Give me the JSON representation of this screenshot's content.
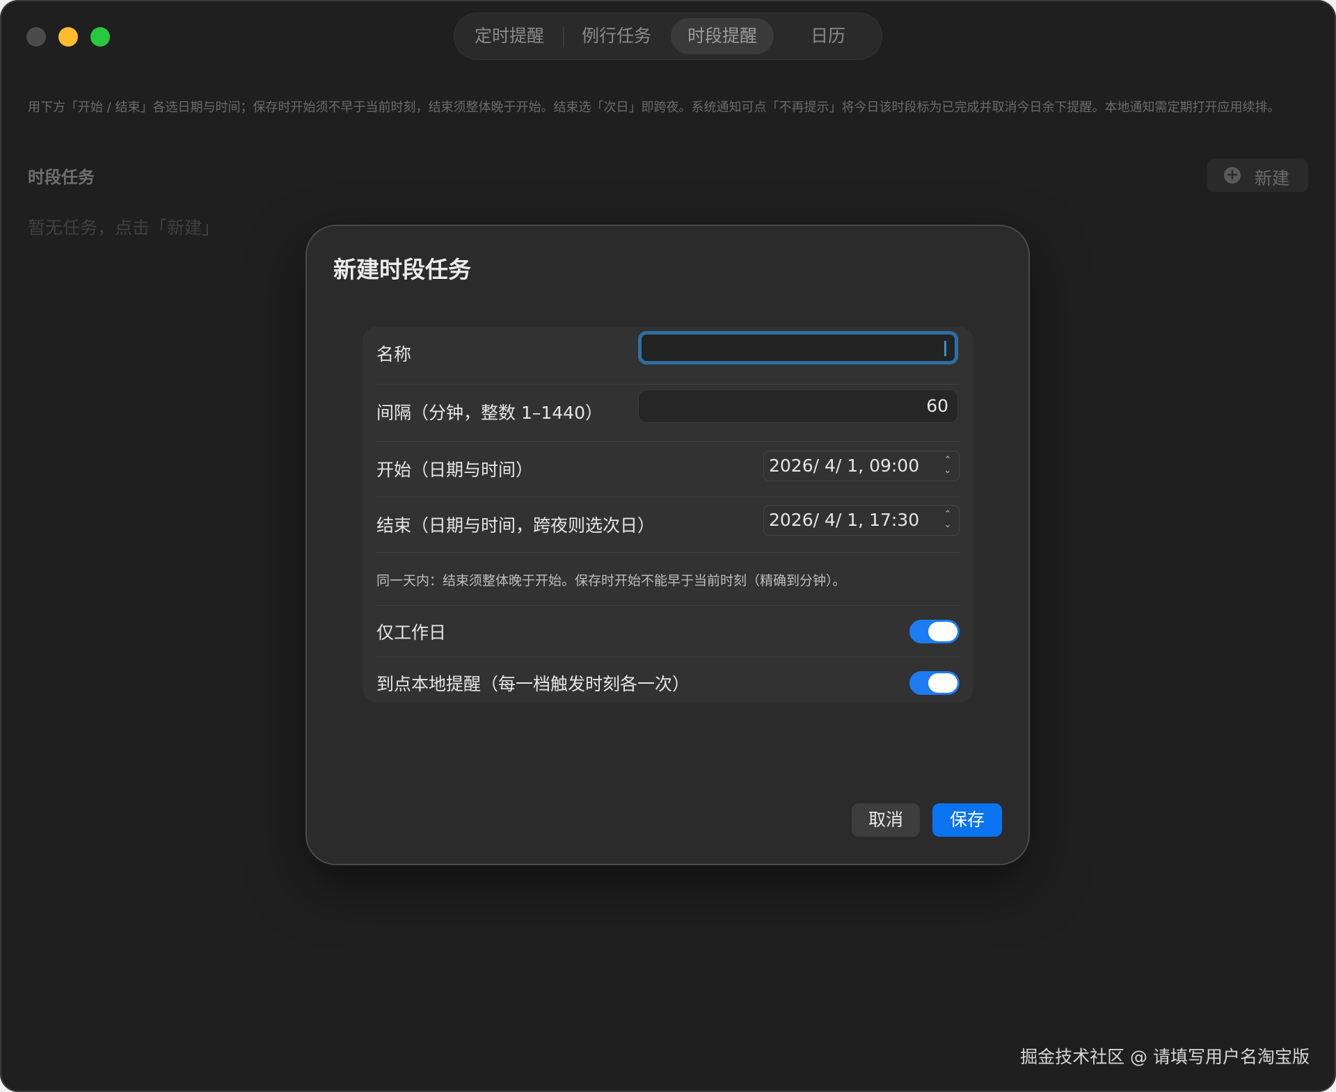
{
  "window": {
    "traffic_lights": [
      "close",
      "minimize",
      "zoom"
    ]
  },
  "tabs": [
    {
      "label": "定时提醒",
      "active": false
    },
    {
      "label": "例行任务",
      "active": false
    },
    {
      "label": "时段提醒",
      "active": true
    },
    {
      "label": "日历",
      "active": false
    }
  ],
  "page": {
    "description": "用下方「开始 / 结束」各选日期与时间；保存时开始须不早于当前时刻，结束须整体晚于开始。结束选「次日」即跨夜。系统通知可点「不再提示」将今日该时段标为已完成并取消今日余下提醒。本地通知需定期打开应用续排。",
    "section_title": "时段任务",
    "new_button_label": "新建",
    "new_button_icon": "plus-circle-icon",
    "empty_hint": "暂无任务，点击「新建」"
  },
  "modal": {
    "title": "新建时段任务",
    "fields": {
      "name_label": "名称",
      "name_value": "",
      "interval_label": "间隔（分钟，整数 1–1440）",
      "interval_value": "60",
      "start_label": "开始（日期与时间）",
      "start_value": "2026/  4/  1, 09:00",
      "end_label": "结束（日期与时间，跨夜则选次日）",
      "end_value": "2026/  4/  1, 17:30",
      "note": "同一天内：结束须整体晚于开始。保存时开始不能早于当前时刻（精确到分钟）。",
      "weekdays_label": "仅工作日",
      "weekdays_on": true,
      "notify_label": "到点本地提醒（每一档触发时刻各一次）",
      "notify_on": true
    },
    "cancel_label": "取消",
    "save_label": "保存"
  },
  "watermark": "掘金技术社区 @ 请填写用户名淘宝版",
  "colors": {
    "accent": "#0a74f0",
    "toggle_on": "#1d7cf2",
    "focus_ring": "#2e6fa3",
    "window_bg": "#1f1f1f",
    "modal_bg": "#2b2b2b"
  }
}
